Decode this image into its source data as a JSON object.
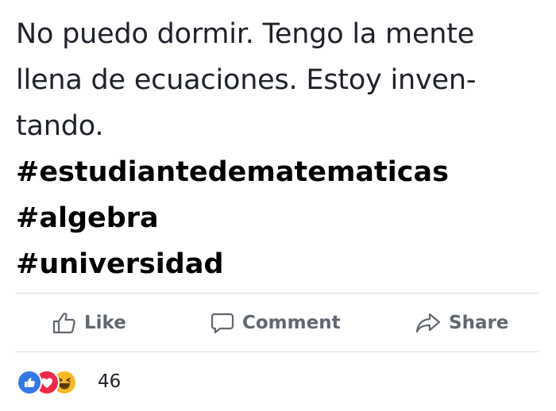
{
  "post": {
    "lines": [
      "No puedo dormir. Tengo la mente",
      "llena de ecuaciones. Estoy inven-",
      "tando."
    ],
    "hashtags": [
      "#estudiantedematematicas",
      "#algebra",
      "#universidad"
    ]
  },
  "actions": {
    "like_label": "Like",
    "comment_label": "Comment",
    "share_label": "Share"
  },
  "reactions": {
    "icons": [
      "like-reaction-icon",
      "love-reaction-icon",
      "haha-reaction-icon"
    ],
    "count": "46"
  },
  "colors": {
    "text": "#1d2129",
    "action_gray": "#606770",
    "like_blue": "#3578e5",
    "love_red": "#f0284a",
    "haha_yellow": "#f7b928",
    "divider": "#dadde1"
  }
}
